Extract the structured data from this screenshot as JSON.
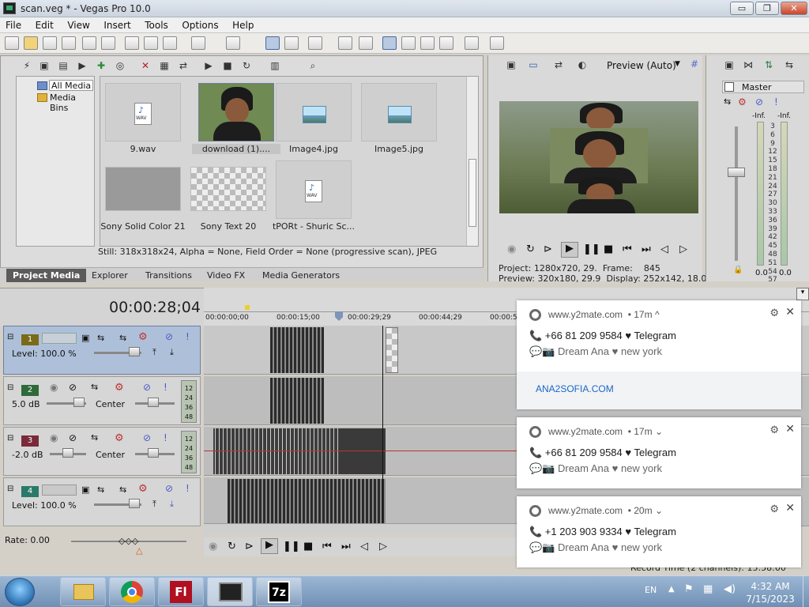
{
  "window": {
    "title": "scan.veg * - Vegas Pro 10.0",
    "min": "▭",
    "max": "❐",
    "close": "✕"
  },
  "menu": [
    "File",
    "Edit",
    "View",
    "Insert",
    "Tools",
    "Options",
    "Help"
  ],
  "media": {
    "tree": [
      "All Media",
      "Media Bins"
    ],
    "items": [
      {
        "label": "9.wav",
        "kind": "wav"
      },
      {
        "label": "download (1)....",
        "kind": "photo"
      },
      {
        "label": "Image4.jpg",
        "kind": "image"
      },
      {
        "label": "Image5.jpg",
        "kind": "image"
      },
      {
        "label": "Sony Solid Color 21",
        "kind": "solid"
      },
      {
        "label": "Sony Text 20",
        "kind": "checker"
      },
      {
        "label": "tPORt - Shuric Sc...",
        "kind": "wav"
      }
    ],
    "wav_tag": "WAV",
    "status": "Still: 318x318x24, Alpha = None, Field Order = None (progressive scan), JPEG",
    "tabs": [
      "Project Media",
      "Explorer",
      "Transitions",
      "Video FX",
      "Media Generators"
    ]
  },
  "preview": {
    "mode": "Preview (Auto)",
    "project_label": "Project:",
    "project_value": "1280x720, 29.",
    "frame_label": "Frame:",
    "frame_value": "845",
    "preview_label": "Preview:",
    "preview_value": "320x180, 29.9",
    "display_label": "Display:",
    "display_value": "252x142, 18.0"
  },
  "master": {
    "title": "Master",
    "inf": "-Inf.",
    "scale": [
      "3",
      "6",
      "9",
      "12",
      "15",
      "18",
      "21",
      "24",
      "27",
      "30",
      "33",
      "36",
      "39",
      "42",
      "45",
      "48",
      "51",
      "54",
      "57"
    ],
    "left_val": "0.0",
    "right_val": "0.0"
  },
  "timeline": {
    "timecode": "00:00:28;04",
    "ruler": [
      "00:00:00;00",
      "00:00:15;00",
      "00:00:29;29",
      "00:00:44;29",
      "00:00:5"
    ],
    "tracks": [
      {
        "num": "1",
        "type": "video",
        "level": "Level: 100.0 %",
        "color": "#7a6a1a"
      },
      {
        "num": "2",
        "type": "audio",
        "level": "5.0 dB",
        "pan": "Center",
        "color": "#2f6a3a"
      },
      {
        "num": "3",
        "type": "audio",
        "level": "-2.0 dB",
        "pan": "Center",
        "color": "#7a2a3a"
      },
      {
        "num": "4",
        "type": "video",
        "level": "Level: 100.0 %",
        "color": "#2a7a6a"
      }
    ],
    "meter_marks": [
      "12",
      "24",
      "36",
      "48"
    ],
    "rate": "Rate: 0.00"
  },
  "bottom_status": "Record Time (2 channels): 15:58:00",
  "notifications": [
    {
      "source": "www.y2mate.com",
      "age": "• 17m",
      "caret": "^",
      "line1": "📞 +66 81 209 9584 ♥ Telegram",
      "line2": "💬📷 Dream Ana ♥ new york",
      "link": "ANA2SOFIA.COM"
    },
    {
      "source": "www.y2mate.com",
      "age": "• 17m",
      "caret": "⌄",
      "line1": "📞 +66 81 209 9584 ♥ Telegram",
      "line2": "💬📷 Dream Ana ♥ new york"
    },
    {
      "source": "www.y2mate.com",
      "age": "• 20m",
      "caret": "⌄",
      "line1": "📞 +1 203 903 9334 ♥ Telegram",
      "line2": "💬📷 Dream Ana ♥ new york"
    }
  ],
  "taskbar": {
    "apps": [
      "explorer",
      "chrome",
      "flash",
      "vegas",
      "7zip"
    ],
    "flash_label": "Fl",
    "zip_label": "7z",
    "lang": "EN",
    "time": "4:32 AM",
    "date": "7/15/2023"
  }
}
